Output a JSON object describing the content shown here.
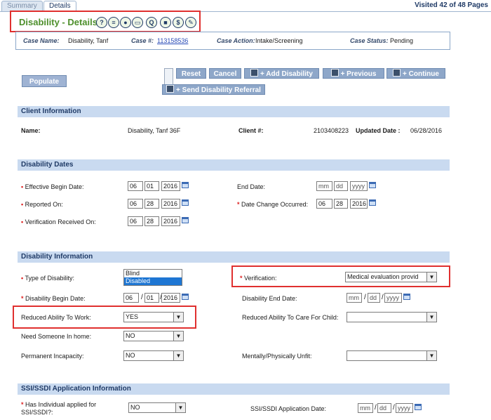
{
  "tabs": [
    {
      "label": "Summary"
    },
    {
      "label": "Details"
    }
  ],
  "visited": "Visited 42 of 48 Pages",
  "page_title": "Disability - Details",
  "title_icons": [
    "help-icon",
    "document-icon",
    "person-icon",
    "copy-icon",
    "search-icon",
    "stop-icon",
    "recycle-icon",
    "note-icon"
  ],
  "case": {
    "name_label": "Case Name:",
    "name_value": "Disability, Tanf",
    "number_label": "Case #:",
    "number_value": "113158536",
    "action_label": "Case Action:",
    "action_value": "Intake/Screening",
    "status_label": "Case Status:",
    "status_value": "Pending"
  },
  "buttons": {
    "populate": "Populate",
    "reset": "Reset",
    "cancel": "Cancel",
    "add_disability": "+ Add Disability",
    "previous": "+ Previous",
    "continue": "+ Continue",
    "send_referral": "+ Send Disability Referral"
  },
  "client_info": {
    "header": "Client Information",
    "name_label": "Name:",
    "name_value": "Disability, Tanf 36F",
    "client_no_label": "Client #:",
    "client_no_value": "2103408223",
    "updated_label": "Updated Date :",
    "updated_value": "06/28/2016"
  },
  "dates": {
    "header": "Disability Dates",
    "effective_label": "Effective Begin Date:",
    "effective": {
      "mm": "06",
      "dd": "01",
      "yyyy": "2016"
    },
    "end_label": "End Date:",
    "end": {
      "mm": "mm",
      "dd": "dd",
      "yyyy": "yyyy"
    },
    "reported_label": "Reported On:",
    "reported": {
      "mm": "06",
      "dd": "28",
      "yyyy": "2016"
    },
    "change_label": "Date Change Occurred:",
    "change": {
      "mm": "06",
      "dd": "28",
      "yyyy": "2016"
    },
    "verification_label": "Verification Received On:",
    "verification": {
      "mm": "06",
      "dd": "28",
      "yyyy": "2016"
    }
  },
  "disability_info": {
    "header": "Disability Information",
    "type_label": "Type of Disability:",
    "type_options": [
      "Blind",
      "Disabled"
    ],
    "type_selected": "Disabled",
    "verification_label": "Verification:",
    "verification_value": "Medical evaluation provid",
    "begin_label": "Disability Begin Date:",
    "begin": {
      "mm": "06",
      "dd": "01",
      "yyyy": "2016"
    },
    "end_label": "Disability End Date:",
    "end": {
      "mm": "mm",
      "dd": "dd",
      "yyyy": "yyyy"
    },
    "reduced_work_label": "Reduced Ability To Work:",
    "reduced_work_value": "YES",
    "reduced_care_label": "Reduced Ability To Care For Child:",
    "reduced_care_value": "",
    "need_someone_label": "Need Someone In home:",
    "need_someone_value": "NO",
    "permanent_label": "Permanent Incapacity:",
    "permanent_value": "NO",
    "unfit_label": "Mentally/Physically Unfit:",
    "unfit_value": ""
  },
  "ssi": {
    "header": "SSI/SSDI Application Information",
    "applied_label_1": "Has Individual applied for",
    "applied_label_2": "SSI/SSDI?:",
    "applied_value": "NO",
    "date_label": "SSI/SSDI Application Date:",
    "date": {
      "mm": "mm",
      "dd": "dd",
      "yyyy": "yyyy"
    }
  },
  "seps": {
    "slash": "/"
  },
  "colors": {
    "accent_green": "#4d8f2b",
    "highlight_red": "#e0302f",
    "section_blue": "#c9daf0",
    "button_blue": "#8ea7c9"
  }
}
